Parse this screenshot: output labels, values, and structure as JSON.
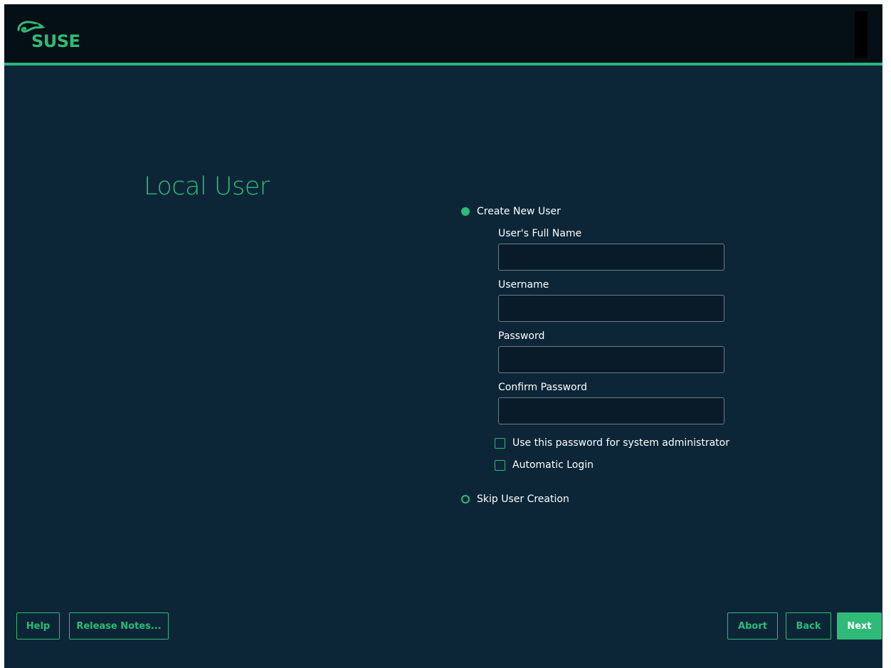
{
  "brand": {
    "logo_text": "SUSE",
    "accent_color": "#30ba78",
    "background_color": "#0c2637",
    "topbar_color": "#050f16"
  },
  "page": {
    "title": "Local User"
  },
  "user_choice": {
    "create_label": "Create New User",
    "create_selected": true,
    "skip_label": "Skip User Creation",
    "skip_selected": false
  },
  "form": {
    "full_name_label": "User's Full Name",
    "full_name_value": "",
    "username_label": "Username",
    "username_value": "",
    "password_label": "Password",
    "password_value": "",
    "confirm_label": "Confirm Password",
    "confirm_value": "",
    "use_for_admin_label": "Use this password for system administrator",
    "use_for_admin_checked": false,
    "auto_login_label": "Automatic Login",
    "auto_login_checked": false
  },
  "buttons": {
    "help": "Help",
    "release_notes": "Release Notes...",
    "abort": "Abort",
    "back": "Back",
    "next": "Next"
  },
  "icons": {
    "logo": "suse-chameleon-logo",
    "radio_on": "radio-selected-icon",
    "radio_off": "radio-unselected-icon",
    "checkbox": "checkbox-icon"
  }
}
